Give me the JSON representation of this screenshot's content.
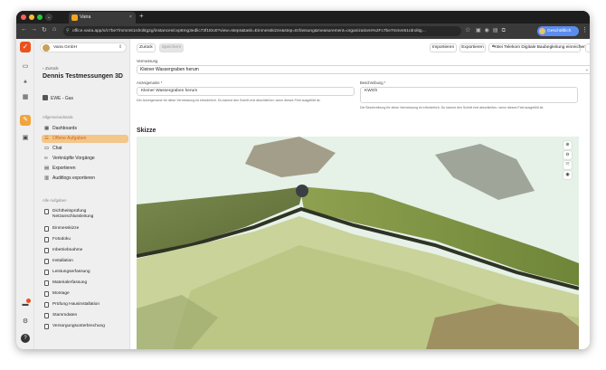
{
  "browser": {
    "tab_title": "Vaira",
    "url": "office.vaira.app/o/c7be7/mmm61rdrolitg2g/instances/cvp8mg3edlic73f1t0o0?view=steps&task=Einmesskizze&step=Erfassung&measurement=organizations%2Fc7be7mmm61rdrolitg…",
    "profile_label": "Geschäftlich"
  },
  "sidebar": {
    "company": "Vaira GmbH",
    "back_label": "Zurück",
    "project_title": "Dennis Testmessungen 3D",
    "project_org": "EWE - Gas",
    "section_general": "Allgemeinedetails",
    "nav": [
      {
        "label": "Dashboards",
        "icon": "grid-icon"
      },
      {
        "label": "Offene Aufgaben",
        "icon": "list-icon",
        "selected": true
      },
      {
        "label": "Chat",
        "icon": "chat-icon"
      },
      {
        "label": "Verknüpfte Vorgänge",
        "icon": "link-icon"
      },
      {
        "label": "Exportieren",
        "icon": "export-icon"
      },
      {
        "label": "Auditlogs exportieren",
        "icon": "audit-icon"
      }
    ],
    "section_tasks": "Alle Aufgaben",
    "tasks": [
      "Dichtheitsprüfung Netzanschlussleitung",
      "Einmesskizze",
      "Fotodoku",
      "Inbetriebnahme",
      "Installation",
      "Leistungserfassung",
      "Materialerfassung",
      "Montage",
      "Prüfung Hausinstallation",
      "Stammdaten",
      "Versorgungsunterbrechung"
    ]
  },
  "toolbar": {
    "back": "Zurück",
    "disabled_btn": "Speichern",
    "import": "Importieren",
    "export": "Exportieren",
    "telekom": "Bei Telekom Digitale Baubegleitung einreichen"
  },
  "form": {
    "measurement_label": "Vermessung",
    "measurement_value": "Kleiner Wassergraben herum",
    "display_name_label": "Anzeigename *",
    "display_name_value": "Kleiner Wassergraben herum",
    "display_name_hint": "Der Anzeigename für diese Vermessung ist erforderlich. Du kannst den Schritt erst abschließen, wenn dieses Feld ausgefüllt ist.",
    "description_label": "Beschreibung *",
    "description_value": "KWGh",
    "description_hint": "Die Beschreibung für diese Vermessung ist erforderlich. Du kannst den Schritt erst abschließen, wenn dieses Feld ausgefüllt ist."
  },
  "sketch": {
    "title": "Skizze",
    "tools": [
      "zoom-in-icon",
      "zoom-out-icon",
      "fit-icon",
      "camera-icon"
    ]
  },
  "colors": {
    "accent": "#e9531d",
    "selected_bg": "#f3c68a",
    "selected_text": "#d2691e"
  }
}
